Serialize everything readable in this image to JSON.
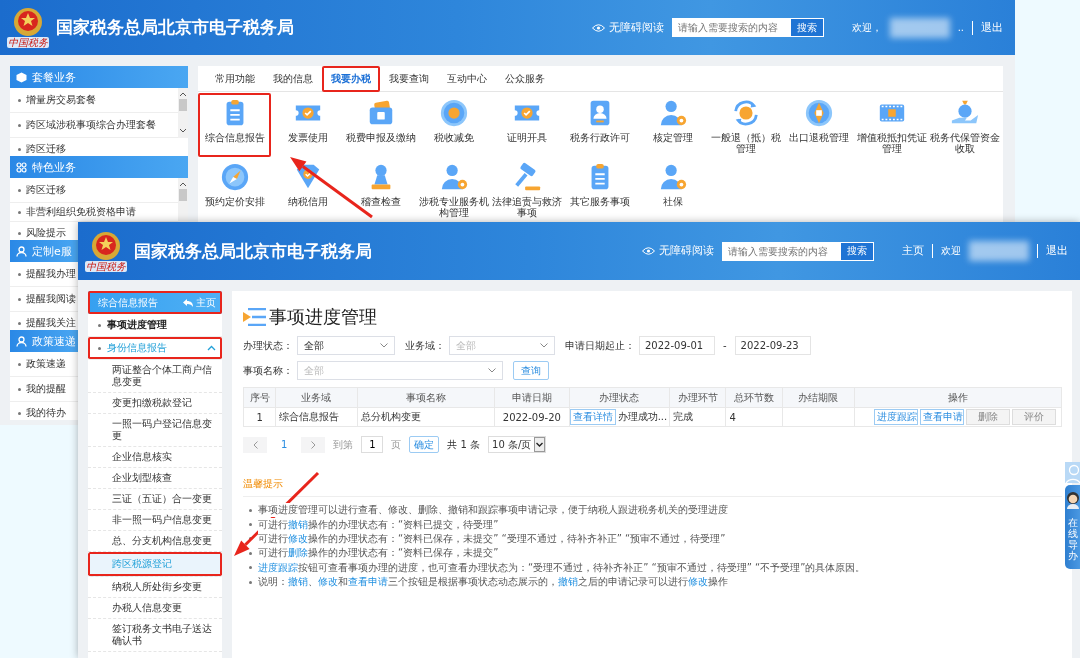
{
  "back_window": {
    "header": {
      "logo_caption": "中国税务",
      "title": "国家税务总局北京市电子税务局",
      "accessibility_link": "无障碍阅读",
      "search": {
        "placeholder": "请输入需要搜索的内容",
        "button": "搜索"
      },
      "welcome": "欢迎，",
      "ellipsis": "..",
      "logout": "退出"
    },
    "sidebar": [
      {
        "title": "套餐业务",
        "items": [
          "增量房交易套餐",
          "跨区域涉税事项综合办理套餐",
          "跨区迁移"
        ]
      },
      {
        "title": "特色业务",
        "items": [
          "跨区迁移",
          "非营利组织免税资格申请",
          "风险提示"
        ]
      },
      {
        "title": "定制e服",
        "items": [
          "提醒我办理",
          "提醒我阅读",
          "提醒我关注"
        ]
      },
      {
        "title": "政策速递",
        "items": [
          "政策速递",
          "我的提醒",
          "我的待办"
        ]
      }
    ],
    "tabs": [
      {
        "label": "常用功能",
        "selected": false,
        "highlighted": false
      },
      {
        "label": "我的信息",
        "selected": false,
        "highlighted": false
      },
      {
        "label": "我要办税",
        "selected": true,
        "highlighted": true
      },
      {
        "label": "我要查询",
        "selected": false,
        "highlighted": false
      },
      {
        "label": "互动中心",
        "selected": false,
        "highlighted": false
      },
      {
        "label": "公众服务",
        "selected": false,
        "highlighted": false
      }
    ],
    "services": [
      {
        "label": "综合信息报告",
        "highlighted": true
      },
      {
        "label": "发票使用",
        "highlighted": false
      },
      {
        "label": "税费申报及缴纳",
        "highlighted": false
      },
      {
        "label": "税收减免",
        "highlighted": false
      },
      {
        "label": "证明开具",
        "highlighted": false
      },
      {
        "label": "税务行政许可",
        "highlighted": false
      },
      {
        "label": "核定管理",
        "highlighted": false
      },
      {
        "label": "一般退（抵）税管理",
        "highlighted": false
      },
      {
        "label": "出口退税管理",
        "highlighted": false
      },
      {
        "label": "增值税抵扣凭证管理",
        "highlighted": false
      },
      {
        "label": "税务代保管资金收取",
        "highlighted": false
      },
      {
        "label": "预约定价安排",
        "highlighted": false
      },
      {
        "label": "纳税信用",
        "highlighted": false
      },
      {
        "label": "稽查检查",
        "highlighted": false
      },
      {
        "label": "涉税专业服务机构管理",
        "highlighted": false
      },
      {
        "label": "法律追责与救济事项",
        "highlighted": false
      },
      {
        "label": "其它服务事项",
        "highlighted": false
      },
      {
        "label": "社保",
        "highlighted": false
      }
    ]
  },
  "front_window": {
    "header": {
      "logo_caption": "中国税务",
      "title": "国家税务总局北京市电子税务局",
      "accessibility_link": "无障碍阅读",
      "search": {
        "placeholder": "请输入需要搜索的内容",
        "button": "搜索"
      },
      "home": "主页",
      "welcome": "欢迎",
      "logout": "退出"
    },
    "sidebar": {
      "header": {
        "title": "综合信息报告",
        "home": "主页",
        "highlighted": true
      },
      "menu": [
        {
          "label": "事项进度管理",
          "current": true,
          "highlighted": false
        },
        {
          "label": "身份信息报告",
          "current": false,
          "highlighted": true,
          "expanded": true,
          "children": [
            {
              "label": "两证整合个体工商户信息变更",
              "selected": false,
              "highlighted": false
            },
            {
              "label": "变更扣缴税款登记",
              "selected": false,
              "highlighted": false
            },
            {
              "label": "一照一码户登记信息变更",
              "selected": false,
              "highlighted": false
            },
            {
              "label": "企业信息核实",
              "selected": false,
              "highlighted": false
            },
            {
              "label": "企业划型核查",
              "selected": false,
              "highlighted": false
            },
            {
              "label": "三证（五证）合一变更",
              "selected": false,
              "highlighted": false
            },
            {
              "label": "非一照一码户信息变更",
              "selected": false,
              "highlighted": false
            },
            {
              "label": "总、分支机构信息变更",
              "selected": false,
              "highlighted": false
            },
            {
              "label": "跨区税源登记",
              "selected": true,
              "highlighted": true
            },
            {
              "label": "纳税人所处街乡变更",
              "selected": false,
              "highlighted": false
            },
            {
              "label": "办税人信息变更",
              "selected": false,
              "highlighted": false
            },
            {
              "label": "签订税务文书电子送达确认书",
              "selected": false,
              "highlighted": false
            }
          ]
        }
      ]
    },
    "page_title": "事项进度管理",
    "filter_rows": [
      [
        {
          "kind": "select",
          "label": "办理状态：",
          "value": "全部"
        },
        {
          "kind": "select",
          "label": "业务域：",
          "placeholder": "全部"
        },
        {
          "kind": "date_range",
          "label": "申请日期起止：",
          "from": "2022-09-01",
          "separator": "-",
          "to": "2022-09-23"
        }
      ],
      [
        {
          "kind": "select",
          "label": "事项名称：",
          "placeholder": "全部"
        },
        {
          "kind": "button",
          "label": "查询"
        }
      ]
    ],
    "table": {
      "columns": [
        "序号",
        "业务域",
        "事项名称",
        "申请日期",
        "办理状态",
        "办理环节",
        "总环节数",
        "办结期限",
        "操作"
      ],
      "rows": [
        {
          "index": "1",
          "domain": "综合信息报告",
          "name": "总分机构变更",
          "date": "2022-09-20",
          "details_button": "查看详情",
          "status": "办理成功...",
          "stage": "完成",
          "total_stages": "4",
          "actions": [
            {
              "label": "进度跟踪",
              "disabled": false
            },
            {
              "label": "查看申请",
              "disabled": false
            },
            {
              "label": "删除",
              "disabled": true
            },
            {
              "label": "评价",
              "disabled": true
            }
          ]
        }
      ]
    },
    "pagination": {
      "current_page": "1",
      "goto_prefix": "到第",
      "goto_value": "1",
      "goto_suffix": "页",
      "confirm": "确定",
      "total": "共 1 条",
      "page_size": "10 条/页"
    },
    "tips": {
      "title": "温馨提示",
      "items": [
        {
          "parts": [
            {
              "text": "事项进度管理可以进行查看、修改、删除、撤销和跟踪事项申请记录，便于纳税人跟进税务机关的受理进度",
              "link": false
            }
          ]
        },
        {
          "parts": [
            {
              "text": "可进行",
              "link": false
            },
            {
              "text": "撤销",
              "link": true
            },
            {
              "text": "操作的办理状态有：“资料已提交，待受理”",
              "link": false
            }
          ]
        },
        {
          "parts": [
            {
              "text": "可进行",
              "link": false
            },
            {
              "text": "修改",
              "link": true
            },
            {
              "text": "操作的办理状态有：“资料已保存，未提交” “受理不通过，待补齐补正” “预审不通过，待受理”",
              "link": false
            }
          ]
        },
        {
          "parts": [
            {
              "text": "可进行",
              "link": false
            },
            {
              "text": "删除",
              "link": true
            },
            {
              "text": "操作的办理状态有：“资料已保存，未提交”",
              "link": false
            }
          ]
        },
        {
          "parts": [
            {
              "text": "进度跟踪",
              "link": true
            },
            {
              "text": "按钮可查看事项办理的进度，也可查看办理状态为：“受理不通过，待补齐补正” “预审不通过，待受理” “不予受理”的具体原因。",
              "link": false
            }
          ]
        },
        {
          "parts": [
            {
              "text": "说明：",
              "link": false
            },
            {
              "text": "撤销",
              "link": true
            },
            {
              "text": "、",
              "link": false
            },
            {
              "text": "修改",
              "link": true
            },
            {
              "text": "和",
              "link": false
            },
            {
              "text": "查看申请",
              "link": true
            },
            {
              "text": "三个按钮是根据事项状态动态展示的，",
              "link": false
            },
            {
              "text": "撤销",
              "link": true
            },
            {
              "text": "之后的申请记录可以进行",
              "link": false
            },
            {
              "text": "修改",
              "link": true
            },
            {
              "text": "操作",
              "link": false
            }
          ]
        }
      ]
    },
    "guide_widget": {
      "label": "在线导办"
    }
  }
}
